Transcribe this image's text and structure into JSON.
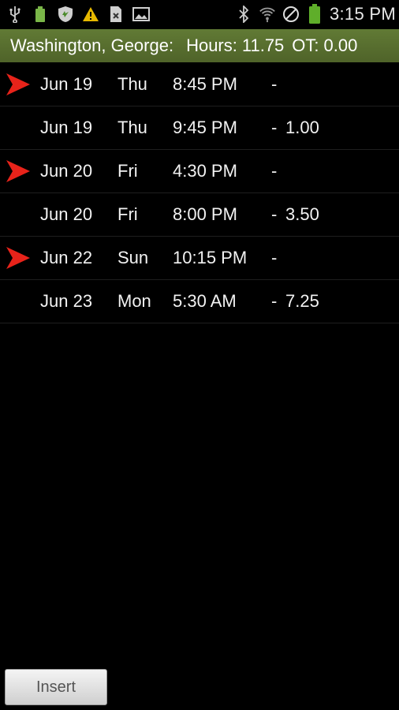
{
  "status_bar": {
    "left_icons": [
      "usb-icon",
      "battery-app-icon",
      "shield-sync-icon",
      "warning-icon",
      "sim-icon",
      "picture-icon"
    ],
    "right_icons": [
      "bluetooth-icon",
      "wifi-icon",
      "no-sound-icon",
      "battery-icon"
    ],
    "time": "3:15 PM"
  },
  "header": {
    "employee": "Washington, George:",
    "hours_label": "Hours:",
    "hours_value": "11.75",
    "ot_label": "OT:",
    "ot_value": "0.00",
    "background": "#556b2f"
  },
  "entries": [
    {
      "in": true,
      "date": "Jun 19",
      "day": "Thu",
      "time": "8:45 PM",
      "dash": "-",
      "hours": ""
    },
    {
      "in": false,
      "date": "Jun 19",
      "day": "Thu",
      "time": "9:45 PM",
      "dash": "-",
      "hours": "1.00"
    },
    {
      "in": true,
      "date": "Jun 20",
      "day": "Fri",
      "time": "4:30 PM",
      "dash": "-",
      "hours": ""
    },
    {
      "in": false,
      "date": "Jun 20",
      "day": "Fri",
      "time": "8:00 PM",
      "dash": "-",
      "hours": "3.50"
    },
    {
      "in": true,
      "date": "Jun 22",
      "day": "Sun",
      "time": "10:15 PM",
      "dash": "-",
      "hours": ""
    },
    {
      "in": false,
      "date": "Jun 23",
      "day": "Mon",
      "time": "5:30 AM",
      "dash": "-",
      "hours": "7.25"
    }
  ],
  "arrow_color": "#e8231a",
  "insert_button": {
    "label": "Insert"
  }
}
